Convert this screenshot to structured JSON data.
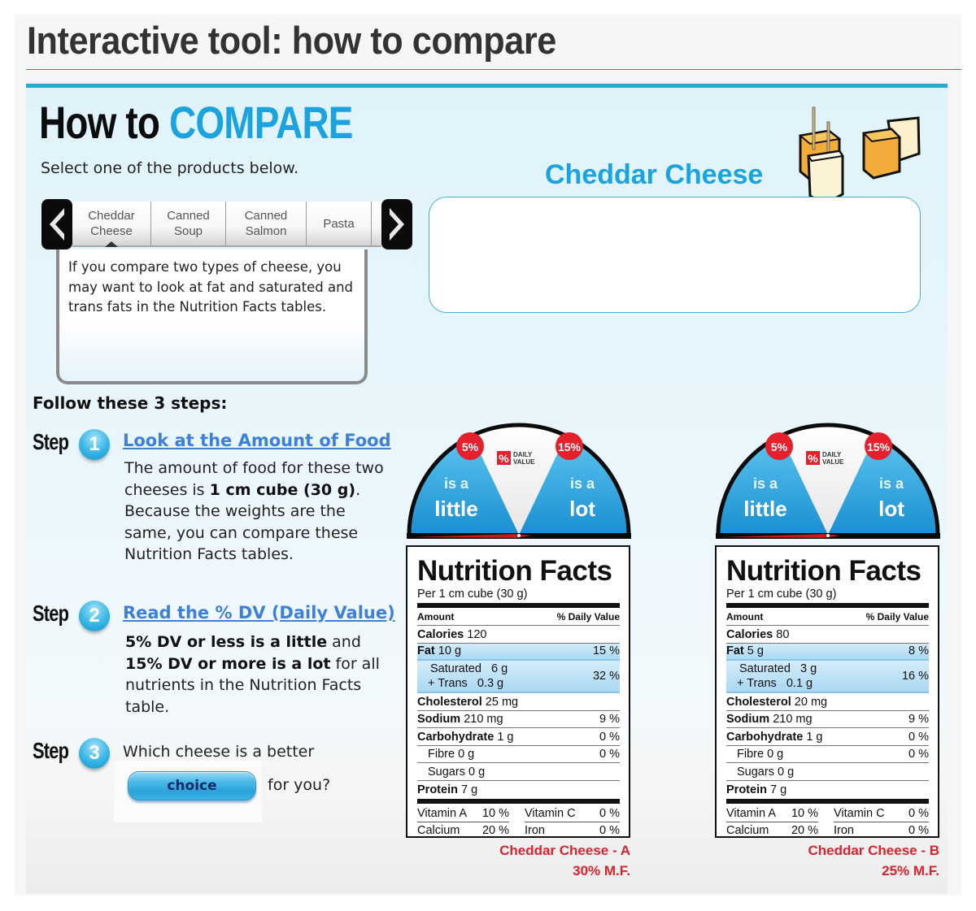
{
  "page": {
    "title": "Interactive tool: how to compare"
  },
  "header": {
    "title_prefix": "How to",
    "title_highlight": "COMPARE",
    "instruction": "Select one of the products below."
  },
  "carousel": {
    "prev_icon": "chevron-left-icon",
    "next_icon": "chevron-right-icon",
    "tabs": [
      {
        "line1": "Cheddar",
        "line2": "Cheese",
        "active": true
      },
      {
        "line1": "Canned",
        "line2": "Soup",
        "active": false
      },
      {
        "line1": "Canned",
        "line2": "Salmon",
        "active": false
      },
      {
        "line1": "Pasta",
        "line2": "",
        "active": false
      }
    ]
  },
  "info_box": {
    "text": "If you compare two types of cheese, you may want to look at fat and saturated and trans fats in the Nutrition Facts tables."
  },
  "product": {
    "name": "Cheddar Cheese",
    "image_icon": "cheese-cubes-icon",
    "description": ""
  },
  "steps": {
    "heading": "Follow these 3 steps:",
    "step_word": "Step",
    "items": [
      {
        "number": "1",
        "link": "Look at the Amount of Food",
        "body_parts": [
          {
            "text": "The amount of food for these two cheeses is ",
            "bold": false
          },
          {
            "text": "1 cm cube (30 g)",
            "bold": true
          },
          {
            "text": ". Because the weights are the same, you can compare these Nutrition Facts tables.",
            "bold": false
          }
        ]
      },
      {
        "number": "2",
        "link": "Read the % DV (Daily Value)",
        "body_parts": [
          {
            "text": "5% DV or less is a little",
            "bold": true
          },
          {
            "text": " and ",
            "bold": false
          },
          {
            "text": "15% DV or more is a lot",
            "bold": true
          },
          {
            "text": " for all nutrients in the Nutrition Facts table.",
            "bold": false
          }
        ]
      },
      {
        "number": "3",
        "question_start": "Which cheese is a better",
        "button_label": "choice",
        "question_end": "for you?"
      }
    ]
  },
  "gauge": {
    "low_threshold": "5%",
    "high_threshold": "15%",
    "logo_line1": "DAILY",
    "logo_line2": "VALUE",
    "logo_symbol": "%",
    "low_text_line1": "is a",
    "low_text_line2": "little",
    "high_text_line1": "is a",
    "high_text_line2": "lot"
  },
  "labels": [
    {
      "title": "Nutrition Facts",
      "serving": "Per 1 cm cube (30 g)",
      "amount_header": "Amount",
      "dv_header": "% Daily Value",
      "calories_label": "Calories",
      "calories": "120",
      "fat_label": "Fat",
      "fat": "10 g",
      "fat_dv": "15 %",
      "saturated_label": "Saturated",
      "saturated": "6 g",
      "trans_label": "+ Trans",
      "trans": "0.3 g",
      "sat_trans_dv": "32 %",
      "cholesterol_label": "Cholesterol",
      "cholesterol": "25 mg",
      "sodium_label": "Sodium",
      "sodium": "210 mg",
      "sodium_dv": "9 %",
      "carb_label": "Carbohydrate",
      "carb": "1 g",
      "carb_dv": "0 %",
      "fibre_label": "Fibre",
      "fibre": "0 g",
      "fibre_dv": "0 %",
      "sugars_label": "Sugars",
      "sugars": "0 g",
      "protein_label": "Protein",
      "protein": "7 g",
      "vitamin_a_label": "Vitamin A",
      "vitamin_a": "10 %",
      "vitamin_c_label": "Vitamin C",
      "vitamin_c": "0 %",
      "calcium_label": "Calcium",
      "calcium": "20 %",
      "iron_label": "Iron",
      "iron": "0 %",
      "caption_name": "Cheddar Cheese - A",
      "caption_mf": "30% M.F."
    },
    {
      "title": "Nutrition Facts",
      "serving": "Per 1 cm cube (30 g)",
      "amount_header": "Amount",
      "dv_header": "% Daily Value",
      "calories_label": "Calories",
      "calories": "80",
      "fat_label": "Fat",
      "fat": "5 g",
      "fat_dv": "8 %",
      "saturated_label": "Saturated",
      "saturated": "3 g",
      "trans_label": "+ Trans",
      "trans": "0.1 g",
      "sat_trans_dv": "16 %",
      "cholesterol_label": "Cholesterol",
      "cholesterol": "20 mg",
      "sodium_label": "Sodium",
      "sodium": "210 mg",
      "sodium_dv": "9 %",
      "carb_label": "Carbohydrate",
      "carb": "1 g",
      "carb_dv": "0 %",
      "fibre_label": "Fibre",
      "fibre": "0 g",
      "fibre_dv": "0 %",
      "sugars_label": "Sugars",
      "sugars": "0 g",
      "protein_label": "Protein",
      "protein": "7 g",
      "vitamin_a_label": "Vitamin A",
      "vitamin_a": "10 %",
      "vitamin_c_label": "Vitamin C",
      "vitamin_c": "0 %",
      "calcium_label": "Calcium",
      "calcium": "20 %",
      "iron_label": "Iron",
      "iron": "0 %",
      "caption_name": "Cheddar Cheese - B",
      "caption_mf": "25% M.F."
    }
  ],
  "colors": {
    "accent_blue": "#1aa3dd",
    "link_blue": "#3d7fd9",
    "caption_red": "#d9232d",
    "gauge_red": "#e3202b",
    "highlight_blue": "#a9d8f3"
  }
}
